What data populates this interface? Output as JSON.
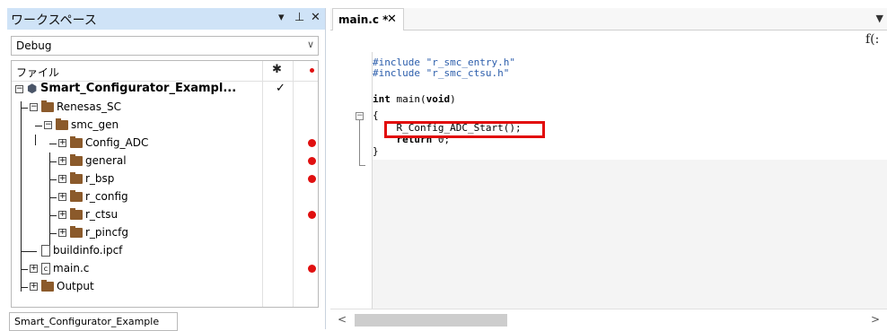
{
  "workspace": {
    "title": "ワークスペース",
    "pin_arrow": "▾",
    "pin": "⊥",
    "close": "✕",
    "configuration": "Debug",
    "column_file": "ファイル",
    "bottom_tab": "Smart_Configurator_Example"
  },
  "tree": [
    {
      "label": "Smart_Configurator_Exampl...",
      "icon": "project-icon",
      "check": "✓"
    },
    {
      "label": "Renesas_SC",
      "icon": "folder-icon",
      "dot": false
    },
    {
      "label": "smc_gen",
      "icon": "folder-icon",
      "dot": false
    },
    {
      "label": "Config_ADC",
      "icon": "folder-icon",
      "dot": true
    },
    {
      "label": "general",
      "icon": "folder-icon",
      "dot": true
    },
    {
      "label": "r_bsp",
      "icon": "folder-icon",
      "dot": true
    },
    {
      "label": "r_config",
      "icon": "folder-icon",
      "dot": false
    },
    {
      "label": "r_ctsu",
      "icon": "folder-icon",
      "dot": true
    },
    {
      "label": "r_pincfg",
      "icon": "folder-icon",
      "dot": false
    },
    {
      "label": "buildinfo.ipcf",
      "icon": "file-icon",
      "dot": false
    },
    {
      "label": "main.c",
      "icon": "c-file-icon",
      "dot": true
    },
    {
      "label": "Output",
      "icon": "folder-icon",
      "dot": false
    }
  ],
  "editor": {
    "tab": "main.c *",
    "tab_close": "✕",
    "fx": "f(:",
    "lines": {
      "l1_pp": "#include ",
      "l1_str": "\"r_smc_entry.h\"",
      "l2_pp": "#include ",
      "l2_str": "\"r_smc_ctsu.h\"",
      "l4_kw": "int",
      "l4_rest": " main(",
      "l4_kw2": "void",
      "l4_end": ")",
      "l5": "{",
      "l6": "    R_Config_ADC_Start();",
      "l7_kw": "    return",
      "l7_rest": " 0;",
      "l8": "}"
    }
  },
  "colors": {
    "accent_red": "#e20b0b",
    "title_bar": "#cfe3f7",
    "folder": "#8b5a2b"
  }
}
